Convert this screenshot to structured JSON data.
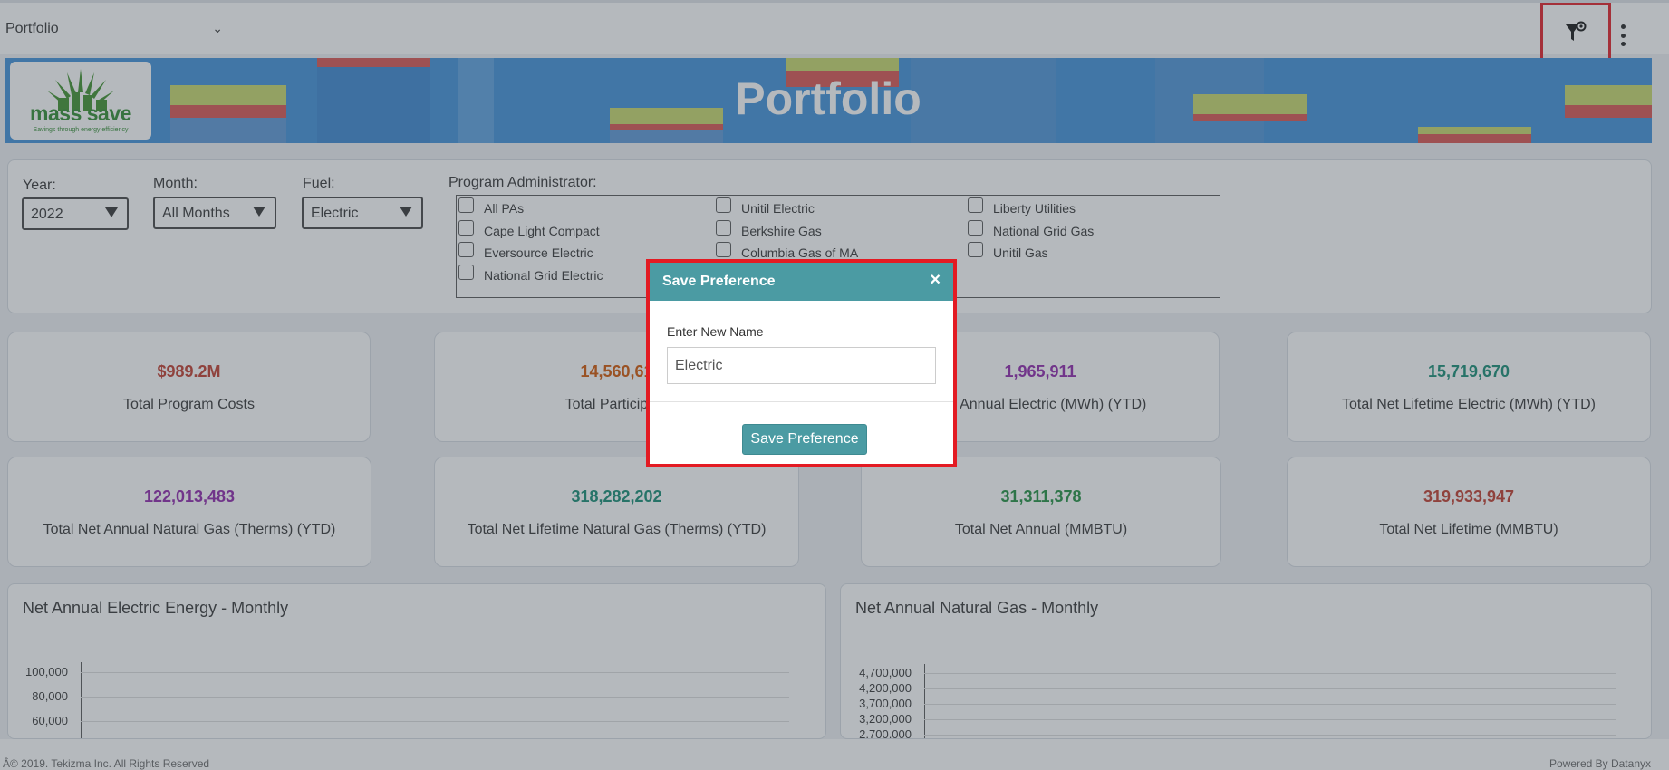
{
  "header": {
    "page_select": "Portfolio",
    "filter_icon": "filter-settings-icon",
    "menu_icon": "vertical-dots-icon"
  },
  "banner": {
    "title": "Portfolio",
    "logo_text": "mass save",
    "logo_tagline": "Savings through energy efficiency"
  },
  "filters": {
    "year_label": "Year:",
    "year_value": "2022",
    "month_label": "Month:",
    "month_value": "All Months",
    "fuel_label": "Fuel:",
    "fuel_value": "Electric",
    "pa_label": "Program Administrator:",
    "pa_options": [
      "All PAs",
      "Cape Light Compact",
      "Eversource Electric",
      "National Grid Electric",
      "Unitil Electric",
      "Berkshire Gas",
      "Columbia Gas of MA",
      "Liberty Utilities",
      "National Grid Gas",
      "Unitil Gas"
    ]
  },
  "cards": [
    {
      "value": "$989.2M",
      "label": "Total Program Costs",
      "color": "#c0392b"
    },
    {
      "value": "14,560,61",
      "label": "Total Participant",
      "color": "#d35400"
    },
    {
      "value": "1,965,911",
      "label": "Net Annual Electric (MWh) (YTD)",
      "color": "#8e24aa"
    },
    {
      "value": "15,719,670",
      "label": "Total Net Lifetime Electric (MWh) (YTD)",
      "color": "#138a72"
    },
    {
      "value": "122,013,483",
      "label": "Total Net Annual Natural Gas (Therms) (YTD)",
      "color": "#8e24aa"
    },
    {
      "value": "318,282,202",
      "label": "Total Net Lifetime Natural Gas (Therms) (YTD)",
      "color": "#138a72"
    },
    {
      "value": "31,311,378",
      "label": "Total Net Annual (MMBTU)",
      "color": "#1e8e3e"
    },
    {
      "value": "319,933,947",
      "label": "Total Net Lifetime (MMBTU)",
      "color": "#c0392b"
    }
  ],
  "charts": {
    "electric_title": "Net Annual Electric Energy - Monthly",
    "electric_ticks": [
      "100,000",
      "80,000",
      "60,000"
    ],
    "gas_title": "Net Annual Natural Gas - Monthly",
    "gas_ticks": [
      "4,700,000",
      "4,200,000",
      "3,700,000",
      "3,200,000",
      "2,700,000"
    ]
  },
  "footer": {
    "copyright": "Â© 2019. Tekizma Inc. All Rights Reserved",
    "powered": "Powered By Datanyx"
  },
  "modal": {
    "title": "Save Preference",
    "close": "×",
    "label": "Enter New Name",
    "input_value": "Electric",
    "button": "Save Preference"
  },
  "colors": {
    "accent_teal": "#4b9ba3",
    "highlight_red": "#e31b23",
    "banner_blue": "#3f8fd9"
  }
}
